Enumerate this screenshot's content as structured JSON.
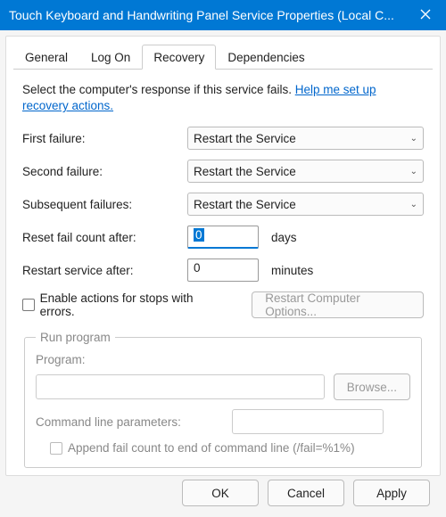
{
  "titlebar": {
    "title": "Touch Keyboard and Handwriting Panel Service Properties (Local C..."
  },
  "tabs": [
    {
      "label": "General"
    },
    {
      "label": "Log On"
    },
    {
      "label": "Recovery"
    },
    {
      "label": "Dependencies"
    }
  ],
  "activeTab": 2,
  "intro": {
    "text": "Select the computer's response if this service fails. ",
    "link": "Help me set up recovery actions."
  },
  "failureRows": [
    {
      "label": "First failure:",
      "value": "Restart the Service"
    },
    {
      "label": "Second failure:",
      "value": "Restart the Service"
    },
    {
      "label": "Subsequent failures:",
      "value": "Restart the Service"
    }
  ],
  "resetCount": {
    "label": "Reset fail count after:",
    "value": "0",
    "unit": "days"
  },
  "restartAfter": {
    "label": "Restart service after:",
    "value": "0",
    "unit": "minutes"
  },
  "enableActions": {
    "label": "Enable actions for stops with errors.",
    "checked": false
  },
  "restartOptionsBtn": "Restart Computer Options...",
  "runProgram": {
    "legend": "Run program",
    "programLabel": "Program:",
    "programValue": "",
    "browse": "Browse...",
    "cmdLabel": "Command line parameters:",
    "cmdValue": "",
    "appendLabel": "Append fail count to end of command line (/fail=%1%)",
    "appendChecked": false
  },
  "footer": {
    "ok": "OK",
    "cancel": "Cancel",
    "apply": "Apply"
  }
}
